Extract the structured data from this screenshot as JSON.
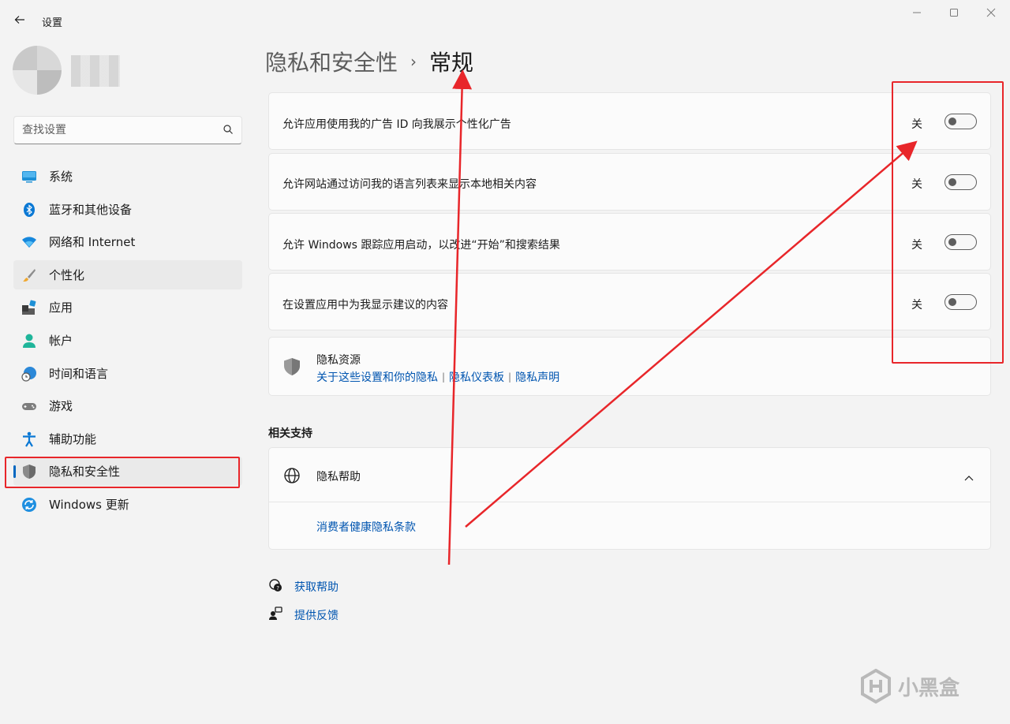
{
  "window": {
    "title": "设置"
  },
  "search": {
    "placeholder": "查找设置"
  },
  "nav": {
    "items": [
      {
        "label": "系统",
        "icon": "monitor-icon"
      },
      {
        "label": "蓝牙和其他设备",
        "icon": "bluetooth-icon"
      },
      {
        "label": "网络和 Internet",
        "icon": "wifi-icon"
      },
      {
        "label": "个性化",
        "icon": "brush-icon"
      },
      {
        "label": "应用",
        "icon": "apps-icon"
      },
      {
        "label": "帐户",
        "icon": "account-icon"
      },
      {
        "label": "时间和语言",
        "icon": "clock-globe-icon"
      },
      {
        "label": "游戏",
        "icon": "gamepad-icon"
      },
      {
        "label": "辅助功能",
        "icon": "accessibility-icon"
      },
      {
        "label": "隐私和安全性",
        "icon": "shield-icon"
      },
      {
        "label": "Windows 更新",
        "icon": "update-icon"
      }
    ],
    "selected": "隐私和安全性"
  },
  "breadcrumb": {
    "parent": "隐私和安全性",
    "separator": "›",
    "current": "常规"
  },
  "settings": [
    {
      "label": "允许应用使用我的广告 ID 向我展示个性化广告",
      "state": "关",
      "on": false
    },
    {
      "label": "允许网站通过访问我的语言列表来显示本地相关内容",
      "state": "关",
      "on": false
    },
    {
      "label": "允许 Windows 跟踪应用启动，以改进“开始”和搜索结果",
      "state": "关",
      "on": false
    },
    {
      "label": "在设置应用中为我显示建议的内容",
      "state": "关",
      "on": false
    }
  ],
  "privacy_resources": {
    "title": "隐私资源",
    "links": [
      "关于这些设置和你的隐私",
      "隐私仪表板",
      "隐私声明"
    ]
  },
  "related": {
    "heading": "相关支持",
    "help_title": "隐私帮助",
    "help_link": "消费者健康隐私条款"
  },
  "footer": {
    "get_help": "获取帮助",
    "feedback": "提供反馈"
  },
  "watermark": {
    "text": "小黑盒"
  },
  "colors": {
    "accent": "#0067c0",
    "annotation_red": "#e8262a",
    "link": "#0055b0"
  }
}
